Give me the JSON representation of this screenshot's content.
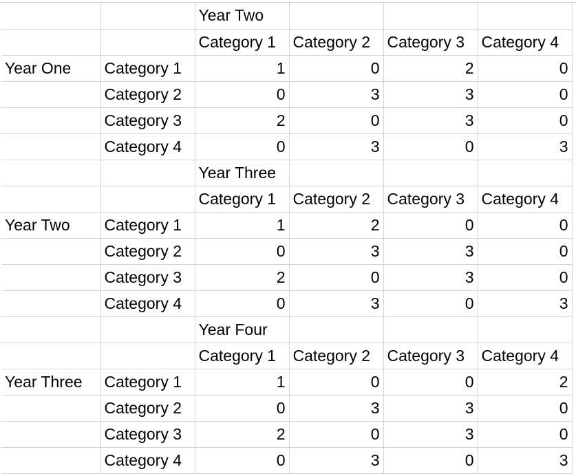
{
  "blocks": [
    {
      "period_label": "Year Two",
      "row_label": "Year One",
      "column_headers": [
        "Category 1",
        "Category 2",
        "Category 3",
        "Category 4"
      ],
      "rows": [
        {
          "label": "Category 1",
          "values": [
            "1",
            "0",
            "2",
            "0"
          ]
        },
        {
          "label": "Category 2",
          "values": [
            "0",
            "3",
            "3",
            "0"
          ]
        },
        {
          "label": "Category 3",
          "values": [
            "2",
            "0",
            "3",
            "0"
          ]
        },
        {
          "label": "Category 4",
          "values": [
            "0",
            "3",
            "0",
            "3"
          ]
        }
      ]
    },
    {
      "period_label": "Year Three",
      "row_label": "Year Two",
      "column_headers": [
        "Category 1",
        "Category 2",
        "Category 3",
        "Category 4"
      ],
      "rows": [
        {
          "label": "Category 1",
          "values": [
            "1",
            "2",
            "0",
            "0"
          ]
        },
        {
          "label": "Category 2",
          "values": [
            "0",
            "3",
            "3",
            "0"
          ]
        },
        {
          "label": "Category 3",
          "values": [
            "2",
            "0",
            "3",
            "0"
          ]
        },
        {
          "label": "Category 4",
          "values": [
            "0",
            "3",
            "0",
            "3"
          ]
        }
      ]
    },
    {
      "period_label": "Year Four",
      "row_label": "Year Three",
      "column_headers": [
        "Category 1",
        "Category 2",
        "Category 3",
        "Category 4"
      ],
      "rows": [
        {
          "label": "Category 1",
          "values": [
            "1",
            "0",
            "0",
            "2"
          ]
        },
        {
          "label": "Category 2",
          "values": [
            "0",
            "3",
            "3",
            "0"
          ]
        },
        {
          "label": "Category 3",
          "values": [
            "2",
            "0",
            "3",
            "0"
          ]
        },
        {
          "label": "Category 4",
          "values": [
            "0",
            "3",
            "0",
            "3"
          ]
        }
      ]
    }
  ]
}
